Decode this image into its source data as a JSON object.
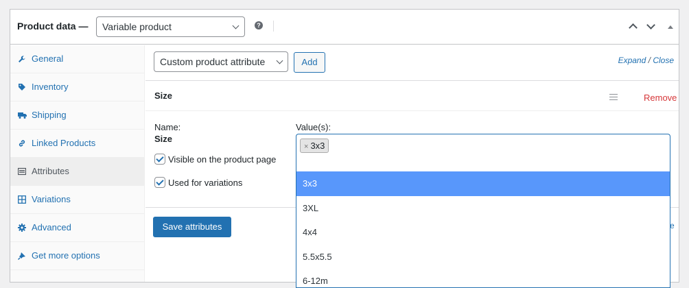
{
  "header": {
    "title": "Product data —",
    "product_type": "Variable product",
    "help_icon": "question-icon"
  },
  "tabs": [
    {
      "label": "General",
      "icon": "wrench-icon"
    },
    {
      "label": "Inventory",
      "icon": "tag-icon"
    },
    {
      "label": "Shipping",
      "icon": "truck-icon"
    },
    {
      "label": "Linked Products",
      "icon": "link-icon"
    },
    {
      "label": "Attributes",
      "icon": "list-icon",
      "active": true
    },
    {
      "label": "Variations",
      "icon": "grid-icon"
    },
    {
      "label": "Advanced",
      "icon": "gear-icon"
    },
    {
      "label": "Get more options",
      "icon": "plugin-icon"
    }
  ],
  "toolbar": {
    "attribute_select": "Custom product attribute",
    "add_label": "Add",
    "expand": "Expand",
    "separator": "/",
    "close": "Close"
  },
  "attribute": {
    "title": "Size",
    "remove": "Remove",
    "name_label": "Name:",
    "name_value": "Size",
    "values_label": "Value(s):",
    "selected_tag": "3x3",
    "tag_remove": "×",
    "visible_label": "Visible on the product page",
    "variations_label": "Used for variations",
    "visible_checked": true,
    "variations_checked": true
  },
  "save_label": "Save attributes",
  "hidden_link": "e",
  "dropdown": {
    "options": [
      "3x3",
      "3XL",
      "4x4",
      "5.5x5.5",
      "6-12m"
    ],
    "highlighted": "3x3"
  },
  "colors": {
    "link": "#2271b1",
    "primary": "#2271b1",
    "remove": "#d63638",
    "highlight": "#5897fb"
  }
}
